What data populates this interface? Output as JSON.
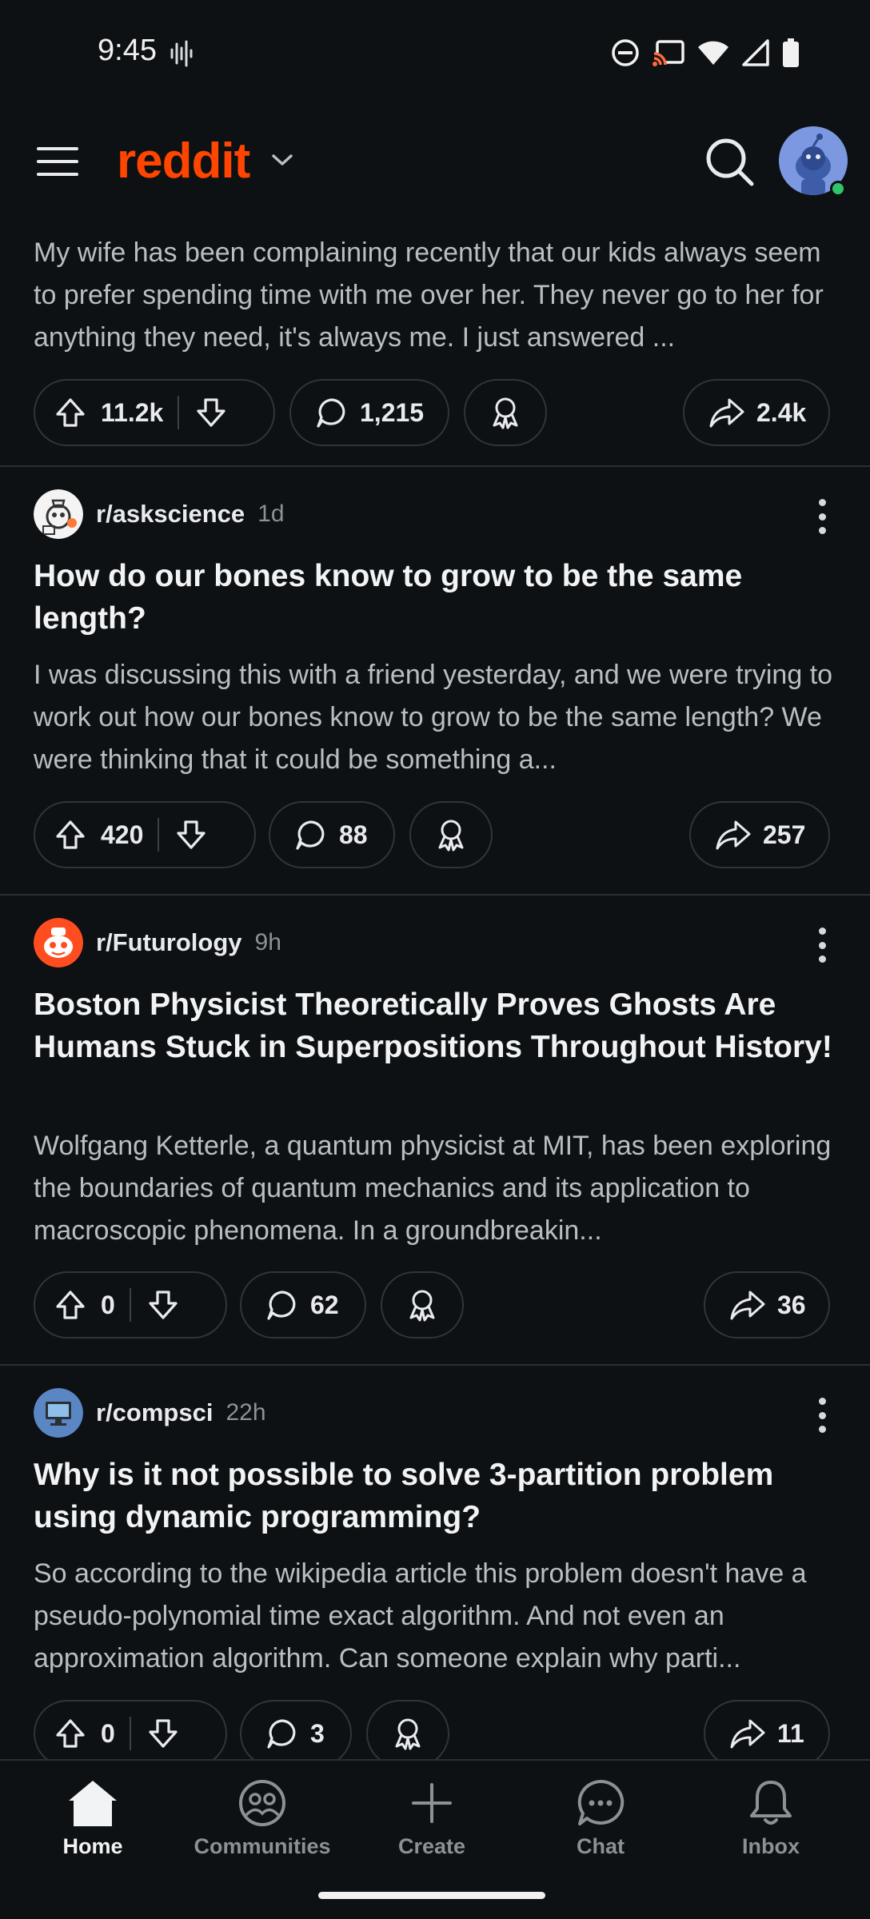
{
  "status_bar": {
    "time": "9:45",
    "icons": [
      "sound-wave-icon",
      "do-not-disturb-icon",
      "cast-icon",
      "wifi-icon",
      "signal-icon",
      "battery-icon"
    ]
  },
  "header": {
    "logo_text": "reddit",
    "icons": [
      "menu-icon",
      "chevron-down-icon",
      "search-icon",
      "avatar"
    ]
  },
  "colors": {
    "brand": "#ff4500",
    "background": "#0e1113",
    "online": "#2fc56a"
  },
  "posts": [
    {
      "body": "My wife has been complaining recently that our kids always seem to prefer spending time with me over her. They never go to her for anything they need, it's always me. I just answered ...",
      "votes": "11.2k",
      "comments": "1,215",
      "shares": "2.4k"
    },
    {
      "subreddit": "r/askscience",
      "age": "1d",
      "title": "How do our bones know to grow to be the same length?",
      "body": "I was discussing this with a friend yesterday, and we were trying to work out how our bones know to grow to be the same length? We were thinking that it could be something a...",
      "votes": "420",
      "comments": "88",
      "shares": "257"
    },
    {
      "subreddit": "r/Futurology",
      "age": "9h",
      "title": "Boston Physicist Theoretically Proves Ghosts Are Humans Stuck in Superpositions Throughout History!",
      "body": "Wolfgang Ketterle, a quantum physicist at MIT, has been exploring the boundaries of quantum mechanics and its application to macroscopic phenomena. In a groundbreakin...",
      "votes": "0",
      "comments": "62",
      "shares": "36"
    },
    {
      "subreddit": "r/compsci",
      "age": "22h",
      "title": "Why is it not possible to solve 3-partition problem using dynamic programming?",
      "body": "So according to the wikipedia article this problem doesn't have a pseudo-polynomial time exact algorithm. And not even an approximation algorithm. Can someone explain why parti...",
      "votes": "0",
      "comments": "3",
      "shares": "11"
    }
  ],
  "bottom_nav": {
    "items": [
      {
        "label": "Home",
        "icon": "home-icon",
        "active": true
      },
      {
        "label": "Communities",
        "icon": "communities-icon"
      },
      {
        "label": "Create",
        "icon": "plus-icon"
      },
      {
        "label": "Chat",
        "icon": "chat-icon"
      },
      {
        "label": "Inbox",
        "icon": "bell-icon"
      }
    ]
  }
}
